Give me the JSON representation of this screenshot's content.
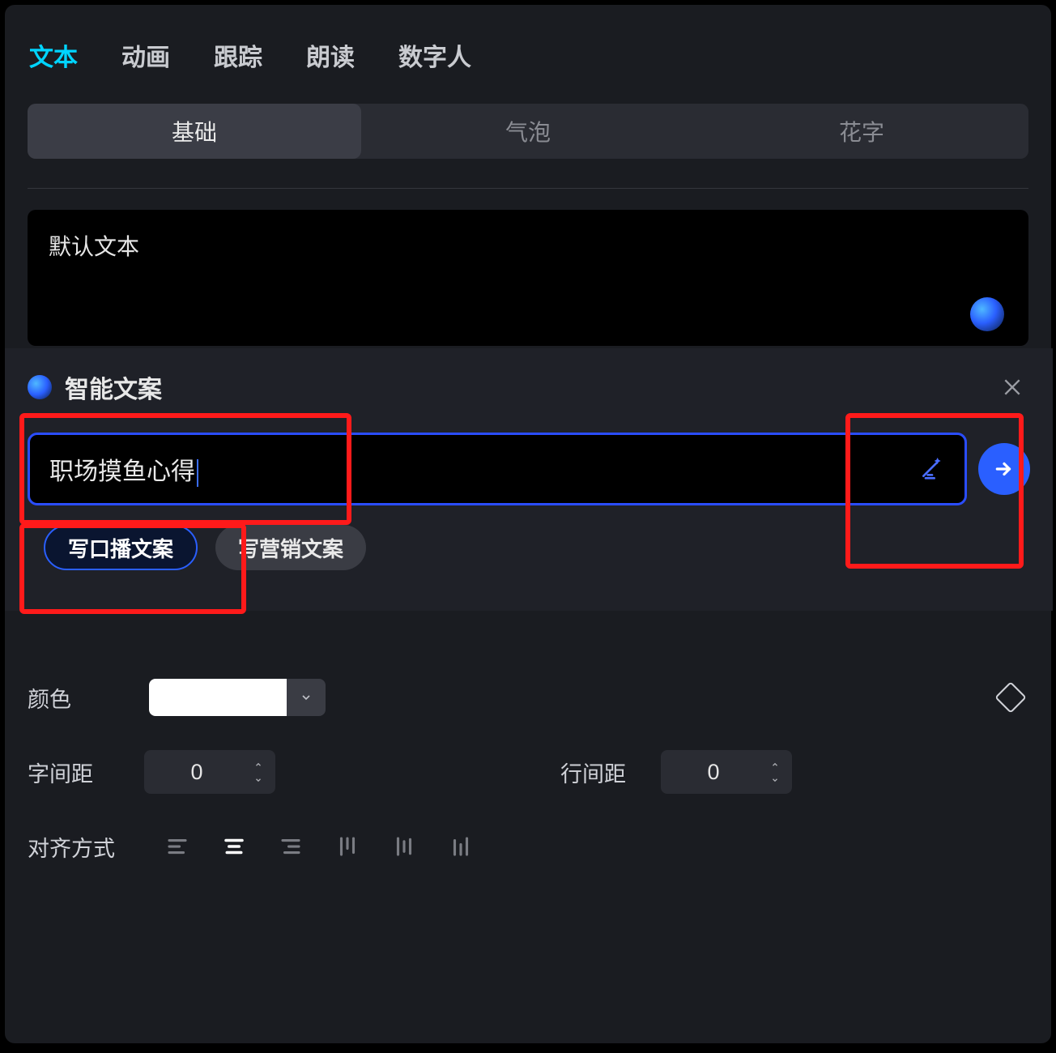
{
  "topTabs": {
    "text": "文本",
    "animation": "动画",
    "tracking": "跟踪",
    "readAloud": "朗读",
    "digitalHuman": "数字人"
  },
  "subTabs": {
    "basic": "基础",
    "bubble": "气泡",
    "fancyText": "花字"
  },
  "textarea": {
    "value": "默认文本"
  },
  "popup": {
    "title": "智能文案",
    "input": "职场摸鱼心得",
    "chip_voiceover": "写口播文案",
    "chip_marketing": "写营销文案"
  },
  "props": {
    "color_label": "颜色",
    "color_value": "#FFFFFF",
    "letter_spacing_label": "字间距",
    "letter_spacing_value": "0",
    "line_spacing_label": "行间距",
    "line_spacing_value": "0",
    "alignment_label": "对齐方式"
  }
}
